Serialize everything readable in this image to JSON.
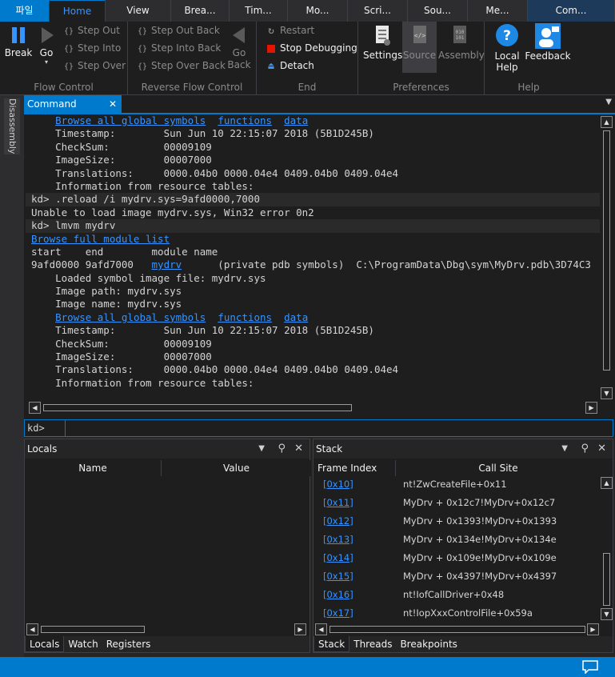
{
  "tabs": [
    "파일",
    "Home",
    "View",
    "Brea...",
    "Tim...",
    "Mo...",
    "Scri...",
    "Sou...",
    "Me...",
    "Com..."
  ],
  "ribbon": {
    "break": "Break",
    "go": "Go",
    "step_out": "Step Out",
    "step_into": "Step Into",
    "step_over": "Step Over",
    "flow_control": "Flow Control",
    "step_out_back": "Step Out Back",
    "step_into_back": "Step Into Back",
    "step_over_back": "Step Over Back",
    "go_back": "Go Back",
    "reverse_flow_control": "Reverse Flow Control",
    "restart": "Restart",
    "stop_debugging": "Stop Debugging",
    "detach": "Detach",
    "end": "End",
    "settings": "Settings",
    "source": "Source",
    "assembly": "Assembly",
    "preferences": "Preferences",
    "local_help": "Local Help",
    "feedback": "Feedback",
    "help": "Help"
  },
  "side": {
    "disassembly": "Disassembly"
  },
  "command": {
    "title": "Command",
    "lines": [
      {
        "t": "    ",
        "l": [
          "Browse all global symbols",
          "functions",
          "data"
        ]
      },
      {
        "t": "    Timestamp:        Sun Jun 10 22:15:07 2018 (5B1D245B)"
      },
      {
        "t": "    CheckSum:         00009109"
      },
      {
        "t": "    ImageSize:        00007000"
      },
      {
        "t": "    Translations:     0000.04b0 0000.04e4 0409.04b0 0409.04e4"
      },
      {
        "t": "    Information from resource tables:"
      },
      {
        "t": "kd> .reload /i mydrv.sys=9afd0000,7000",
        "hl": true
      },
      {
        "t": "Unable to load image mydrv.sys, Win32 error 0n2"
      },
      {
        "t": "kd> lmvm mydrv",
        "hl": true
      },
      {
        "t": "",
        "l": [
          "Browse full module list"
        ]
      },
      {
        "t": "start    end        module name"
      },
      {
        "t": "9afd0000 9afd7000   ",
        "m": "mydrv",
        "r": "      (private pdb symbols)  C:\\ProgramData\\Dbg\\sym\\MyDrv.pdb\\3D74C3"
      },
      {
        "t": "    Loaded symbol image file: mydrv.sys"
      },
      {
        "t": "    Image path: mydrv.sys"
      },
      {
        "t": "    Image name: mydrv.sys"
      },
      {
        "t": "    ",
        "l": [
          "Browse all global symbols",
          "functions",
          "data"
        ]
      },
      {
        "t": "    Timestamp:        Sun Jun 10 22:15:07 2018 (5B1D245B)"
      },
      {
        "t": "    CheckSum:         00009109"
      },
      {
        "t": "    ImageSize:        00007000"
      },
      {
        "t": "    Translations:     0000.04b0 0000.04e4 0409.04b0 0409.04e4"
      },
      {
        "t": "    Information from resource tables:"
      }
    ],
    "prompt": "kd>"
  },
  "locals": {
    "title": "Locals",
    "col_name": "Name",
    "col_value": "Value",
    "tabs": [
      "Locals",
      "Watch",
      "Registers"
    ]
  },
  "stack": {
    "title": "Stack",
    "col_frame": "Frame Index",
    "col_site": "Call Site",
    "rows": [
      {
        "frame": "[0x10]",
        "site": "nt!ZwCreateFile+0x11"
      },
      {
        "frame": "[0x11]",
        "site": "MyDrv + 0x12c7!MyDrv+0x12c7"
      },
      {
        "frame": "[0x12]",
        "site": "MyDrv + 0x1393!MyDrv+0x1393"
      },
      {
        "frame": "[0x13]",
        "site": "MyDrv + 0x134e!MyDrv+0x134e"
      },
      {
        "frame": "[0x14]",
        "site": "MyDrv + 0x109e!MyDrv+0x109e"
      },
      {
        "frame": "[0x15]",
        "site": "MyDrv + 0x4397!MyDrv+0x4397"
      },
      {
        "frame": "[0x16]",
        "site": "nt!IofCallDriver+0x48"
      },
      {
        "frame": "[0x17]",
        "site": "nt!IopXxxControlFile+0x59a"
      }
    ],
    "tabs": [
      "Stack",
      "Threads",
      "Breakpoints"
    ]
  }
}
